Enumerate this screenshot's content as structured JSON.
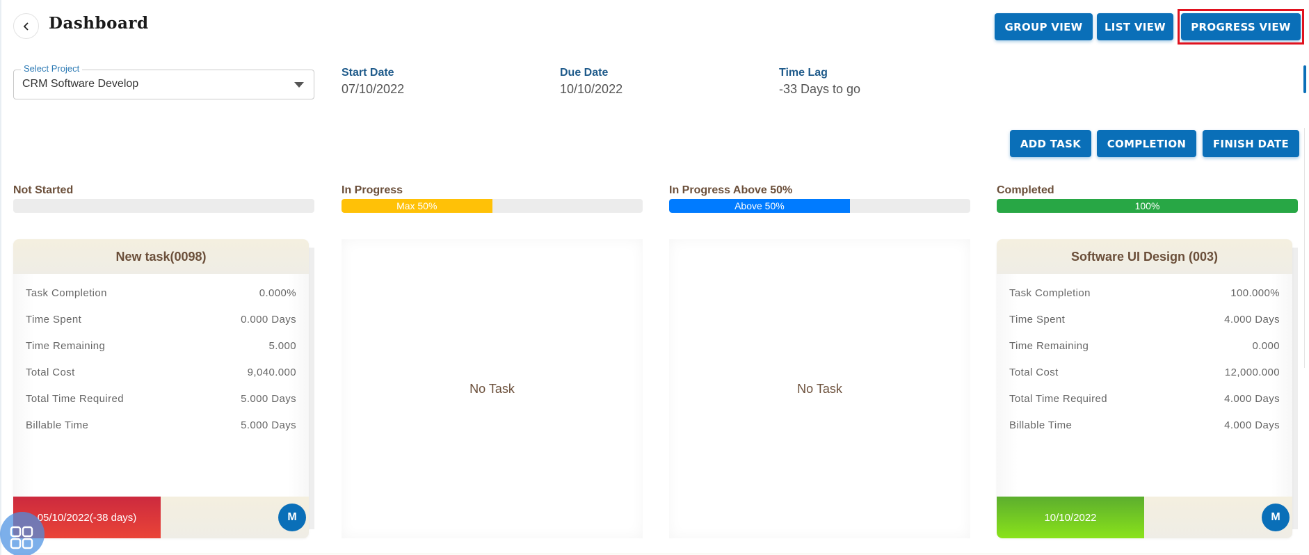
{
  "header": {
    "title": "Dashboard",
    "back_icon": "chevron-left-icon",
    "view_buttons": [
      "GROUP VIEW",
      "LIST VIEW",
      "PROGRESS VIEW"
    ],
    "active_view": "PROGRESS VIEW"
  },
  "project": {
    "select_label": "Select Project",
    "selected": "CRM Software Develop",
    "start_date_label": "Start Date",
    "start_date": "07/10/2022",
    "due_date_label": "Due Date",
    "due_date": "10/10/2022",
    "time_lag_label": "Time Lag",
    "time_lag": "-33 Days to go"
  },
  "actions": [
    "ADD TASK",
    "COMPLETION",
    "FINISH DATE"
  ],
  "statuses": [
    {
      "label": "Not Started",
      "bar_text": "",
      "fill_percent": 0,
      "color": "#ececec"
    },
    {
      "label": "In Progress",
      "bar_text": "Max 50%",
      "fill_percent": 50,
      "color": "#ffc107"
    },
    {
      "label": "In Progress Above 50%",
      "bar_text": "Above 50%",
      "fill_percent": 60,
      "color": "#007bff"
    },
    {
      "label": "Completed",
      "bar_text": "100%",
      "fill_percent": 100,
      "color": "#28a745"
    }
  ],
  "columns": [
    {
      "task": {
        "title": "New task(0098)",
        "metrics": [
          {
            "label": "Task Completion",
            "value": "0.000%"
          },
          {
            "label": "Time Spent",
            "value": "0.000 Days"
          },
          {
            "label": "Time Remaining",
            "value": "5.000"
          },
          {
            "label": "Total Cost",
            "value": "9,040.000"
          },
          {
            "label": "Total Time Required",
            "value": "5.000 Days"
          },
          {
            "label": "Billable Time",
            "value": "5.000 Days"
          }
        ],
        "due": "05/10/2022(-38 days)",
        "due_status": "overdue",
        "assignee_initial": "M"
      }
    },
    {
      "empty_text": "No Task"
    },
    {
      "empty_text": "No Task"
    },
    {
      "task": {
        "title": "Software UI Design (003)",
        "metrics": [
          {
            "label": "Task Completion",
            "value": "100.000%"
          },
          {
            "label": "Time Spent",
            "value": "4.000 Days"
          },
          {
            "label": "Time Remaining",
            "value": "0.000"
          },
          {
            "label": "Total Cost",
            "value": "12,000.000"
          },
          {
            "label": "Total Time Required",
            "value": "4.000 Days"
          },
          {
            "label": "Billable Time",
            "value": "4.000 Days"
          }
        ],
        "due": "10/10/2022",
        "due_status": "on-time",
        "assignee_initial": "M"
      }
    }
  ],
  "colors": {
    "primary": "#0a6fb8",
    "highlight": "#e0121f",
    "overdue": "#dc3545",
    "on_time": "#7ed321",
    "card_header": "#f4efdf"
  },
  "fab_icon": "app-grid-icon"
}
